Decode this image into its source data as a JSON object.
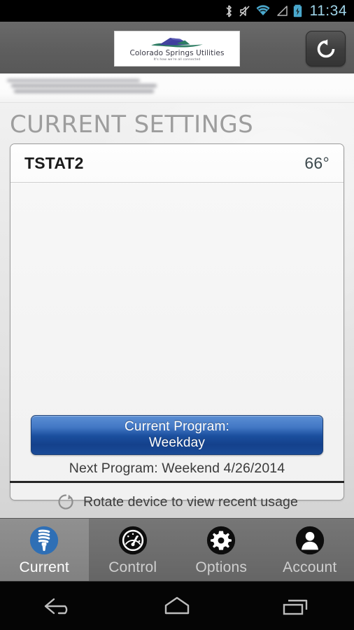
{
  "statusbar": {
    "time": "11:34",
    "icons": [
      "bluetooth-icon",
      "mute-icon",
      "wifi-icon",
      "signal-icon",
      "battery-charging-icon"
    ]
  },
  "header": {
    "logo_name": "Colorado Springs Utilities",
    "logo_tagline": "It's how we're all connected",
    "refresh_label": "refresh-icon"
  },
  "account_bar": {
    "redacted": ""
  },
  "main": {
    "title": "CURRENT SETTINGS",
    "thermostats": [
      {
        "name": "TSTAT2",
        "temperature": "66°"
      }
    ],
    "program_button": {
      "line1": "Current Program:",
      "line2": "Weekday"
    },
    "next_program": "Next Program: Weekend 4/26/2014",
    "rotate_hint": "Rotate device to view recent usage"
  },
  "tabs": [
    {
      "label": "Current",
      "icon": "cfl-bulb-icon",
      "active": true
    },
    {
      "label": "Control",
      "icon": "gauge-icon",
      "active": false
    },
    {
      "label": "Options",
      "icon": "gear-icon",
      "active": false
    },
    {
      "label": "Account",
      "icon": "person-icon",
      "active": false
    }
  ],
  "navbar": {
    "back": "back-icon",
    "home": "home-icon",
    "recents": "recents-icon"
  },
  "colors": {
    "accent_blue": "#1b4f9e",
    "header_gray": "#636363",
    "title_gray": "#9d9d9d",
    "tab_active_bg": "#8a8a8a",
    "clock_blue": "#9fd4e8"
  }
}
